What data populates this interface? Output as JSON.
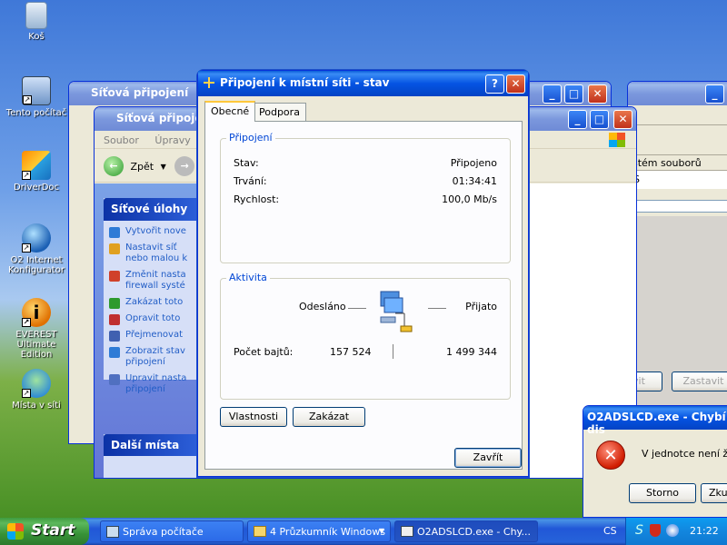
{
  "desktop": {
    "icons": [
      {
        "label": "Koš"
      },
      {
        "label": "Tento počítač"
      },
      {
        "label": "DriverDoc"
      },
      {
        "label": "O2 Internet Konfigurator"
      },
      {
        "label": "EVEREST Ultimate Edition"
      },
      {
        "label": "Místa v síti"
      }
    ]
  },
  "bg_windows": {
    "back_title": "Síťová připojení",
    "front_title": "Síťová připojení",
    "menu": [
      "Soubor",
      "Úpravy"
    ],
    "back_label": "Zpět",
    "tasks_header": "Síťové úlohy",
    "tasks": [
      "Vytvořit nove",
      "Nastavit síť nebo malou k",
      "Změnit nasta firewall systé",
      "Zakázat toto",
      "Opravit toto",
      "Přejmenovat",
      "Zobrazit stav připojení",
      "Upravit nasta připojení"
    ],
    "other_places": "Další místa",
    "right_col_header": "stém souborů",
    "right_col_value": "S",
    "btn_partial_1": "vit",
    "btn_partial_2": "Zastavit"
  },
  "dialog": {
    "title": "Připojení k místní síti - stav",
    "help_btn": "?",
    "tabs": [
      "Obecné",
      "Podpora"
    ],
    "connection_group": "Připojení",
    "status_label": "Stav:",
    "status_value": "Připojeno",
    "duration_label": "Trvání:",
    "duration_value": "01:34:41",
    "speed_label": "Rychlost:",
    "speed_value": "100,0 Mb/s",
    "activity_group": "Aktivita",
    "sent_label": "Odesláno",
    "received_label": "Přijato",
    "bytes_label": "Počet bajtů:",
    "bytes_sent": "157 524",
    "bytes_received": "1 499 344",
    "properties_btn": "Vlastnosti",
    "disable_btn": "Zakázat",
    "close_btn": "Zavřít"
  },
  "error_popup": {
    "title": "O2ADSLCD.exe - Chybí dis",
    "message": "V jednotce není žád",
    "cancel_btn": "Storno",
    "retry_btn": "Zkus"
  },
  "taskbar": {
    "start_label": "Start",
    "tasks": [
      {
        "label": "Správa počítače"
      },
      {
        "label": "4 Průzkumník Windows"
      },
      {
        "label": "O2ADSLCD.exe - Chy..."
      }
    ],
    "language": "CS",
    "clock": "21:22"
  }
}
